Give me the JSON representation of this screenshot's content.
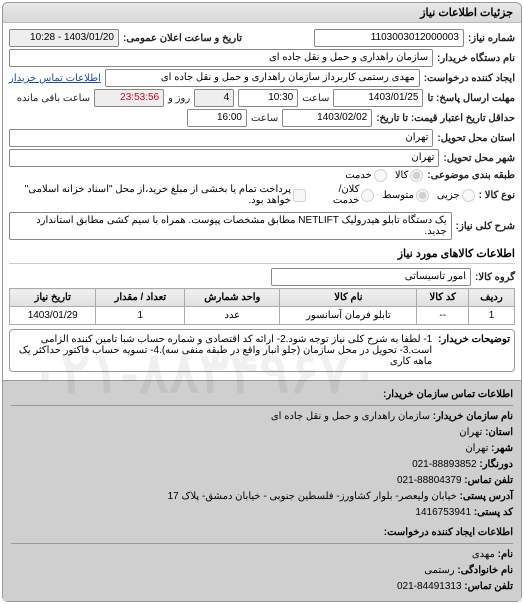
{
  "panel_title": "جزئیات اطلاعات نیاز",
  "labels": {
    "req_no": "شماره نیاز:",
    "announce_dt": "تاریخ و ساعت اعلان عمومی:",
    "buyer_org": "نام دستگاه خریدار:",
    "requester": "ایجاد کننده درخواست:",
    "contact_link": "اطلاعات تماس خریدار",
    "deadline_from": "مهلت ارسال پاسخ: تا",
    "validity": "حداقل تاریخ اعتبار قیمت: تا تاریخ:",
    "delivery_province": "استان محل تحویل:",
    "delivery_city": "شهر محل تحویل:",
    "category": "طبقه بندی موضوعی:",
    "commodity": "نوع کالا :",
    "prepay": "پرداخت تمام یا بخشی از مبلغ خرید،از محل \"اسناد خزانه اسلامی\" خواهد بود.",
    "general_title": "شرح کلی نیاز:",
    "items_title": "اطلاعات کالاهای مورد نیاز",
    "group": "گروه کالا:",
    "saat": "ساعت",
    "rooz": "روز و",
    "remain": "ساعت باقی مانده",
    "buyer_desc": "توضیحات خریدار:",
    "cat_goods": "کالا",
    "cat_service": "خدمت",
    "com_small": "جزیی",
    "com_med": "متوسط",
    "com_large": "کلان/خدمت"
  },
  "values": {
    "req_no": "1103003012000003",
    "announce_dt": "1403/01/20 - 10:28",
    "buyer_org": "سازمان راهداری و حمل و نقل جاده ای",
    "requester": "مهدی رستمی کاربرداز سازمان راهداری و حمل و نقل جاده ای",
    "deadline_date": "1403/01/25",
    "deadline_time": "10:30",
    "deadline_days": "4",
    "deadline_remain": "23:53:56",
    "validity_date": "1403/02/02",
    "validity_time": "16:00",
    "delivery_province": "تهران",
    "delivery_city": "تهران",
    "general_title": "یک دستگاه تابلو هیدرولیک NETLIFT مطابق مشخصات پیوست. همراه با سیم کشی مطابق استاندارد جدید.",
    "group": "امور تاسیساتی",
    "buyer_desc": "1- لطفا به شرح کلی نیاز توجه شود.2- ارائه کد اقتصادی و شماره حساب شبا تامین کننده الزامی است.3- تحویل در محل سازمان (جلو انبار واقع در طبقه منفی سه).4- تسویه حساب فاکتور حداکثر یک ماهه کاری"
  },
  "table": {
    "headers": {
      "row": "ردیف",
      "code": "کد کالا",
      "name": "نام کالا",
      "unit": "واحد شمارش",
      "qty": "تعداد / مقدار",
      "date": "تاریخ نیاز"
    },
    "rows": [
      {
        "row": "1",
        "code": "--",
        "name": "تابلو فرمان آسانسور",
        "unit": "عدد",
        "qty": "1",
        "date": "1403/01/29"
      }
    ]
  },
  "contact": {
    "head": "اطلاعات تماس سازمان خریدار:",
    "org_l": "نام سازمان خریدار:",
    "org_v": "سازمان راهداری و حمل و نقل جاده ای",
    "prov_l": "استان:",
    "prov_v": "تهران",
    "city_l": "شهر:",
    "city_v": "تهران",
    "fax_l": "دورنگار:",
    "fax_v": "88893852-021",
    "phone_l": "تلفن تماس:",
    "phone_v": "88804379-021",
    "addr_l": "آدرس پستی:",
    "addr_v": "خیابان ولیعصر- بلوار کشاورز- فلسطین جنوبی - خیابان دمشق- پلاک 17",
    "post_l": "کد پستی:",
    "post_v": "1416753941",
    "req_head": "اطلاعات ایجاد کننده درخواست:",
    "name_l": "نام:",
    "name_v": "مهدی",
    "fam_l": "نام خانوادگی:",
    "fam_v": "رستمی",
    "tel_l": "تلفن تماس:",
    "tel_v": "84491313-021"
  },
  "watermark": "۰۲۱-۸۸۳۴۹۶۷۰"
}
